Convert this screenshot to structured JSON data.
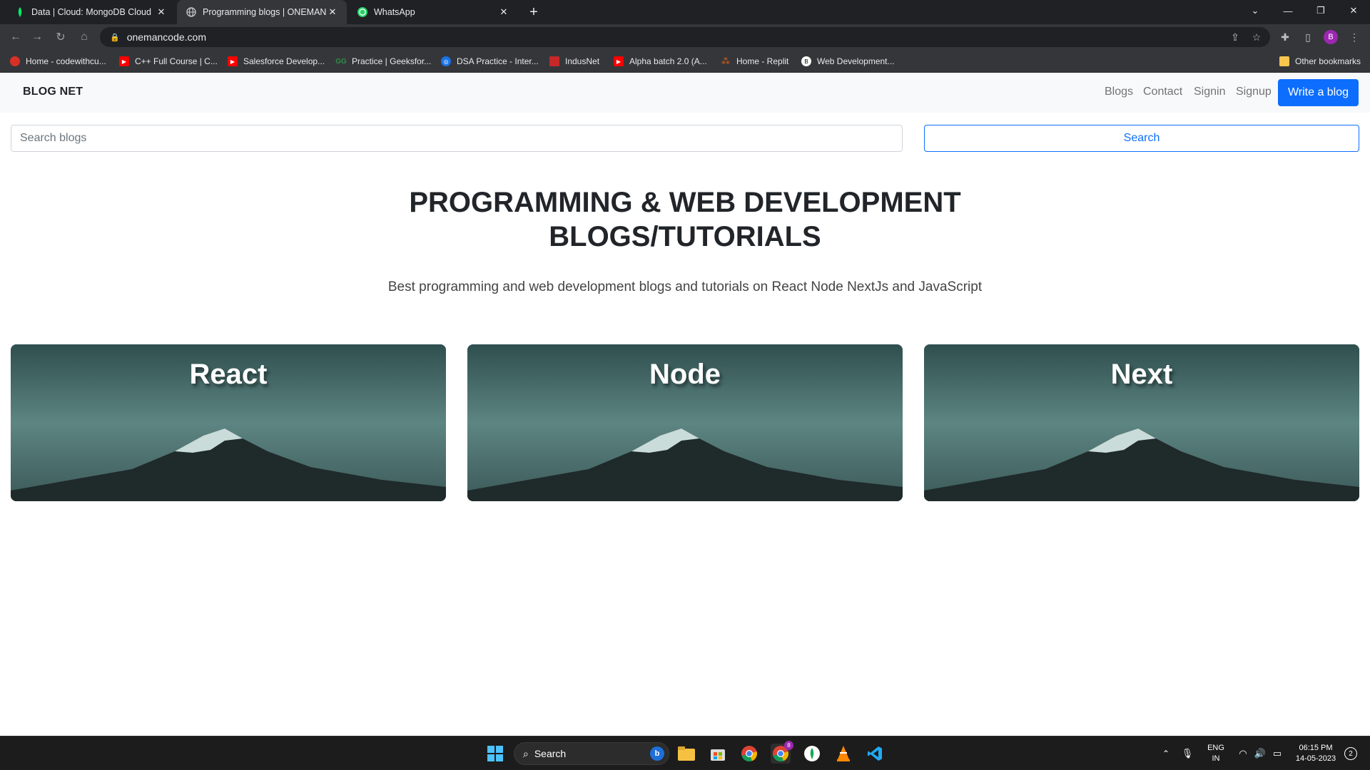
{
  "browser": {
    "tabs": [
      {
        "title": "Data | Cloud: MongoDB Cloud",
        "icon": "mongodb-leaf-icon",
        "active": false
      },
      {
        "title": "Programming blogs | ONEMANCODE",
        "icon": "globe-icon",
        "active": true
      },
      {
        "title": "WhatsApp",
        "icon": "whatsapp-icon",
        "active": false
      }
    ],
    "url": "onemancode.com",
    "profile_initial": "B",
    "bookmarks": [
      {
        "label": "Home - codewithcu...",
        "icon": "codewithharry-icon",
        "color": "#d93025"
      },
      {
        "label": "C++ Full Course | C...",
        "icon": "youtube-icon",
        "color": "#ff0000"
      },
      {
        "label": "Salesforce Develop...",
        "icon": "youtube-icon",
        "color": "#ff0000"
      },
      {
        "label": "Practice | Geeksfor...",
        "icon": "geeksforgeeks-icon",
        "color": "#2f8d46"
      },
      {
        "label": "DSA Practice - Inter...",
        "icon": "interviewbit-icon",
        "color": "#1a73e8"
      },
      {
        "label": "IndusNet",
        "icon": "indusnet-icon",
        "color": "#c62828"
      },
      {
        "label": "Alpha batch 2.0 (A...",
        "icon": "youtube-icon",
        "color": "#ff0000"
      },
      {
        "label": "Home - Replit",
        "icon": "replit-icon",
        "color": "#f26207"
      },
      {
        "label": "Web Development...",
        "icon": "webdev-icon",
        "color": "#ffffff"
      }
    ],
    "other_bookmarks": "Other bookmarks"
  },
  "navbar": {
    "brand": "BLOG NET",
    "links": [
      "Blogs",
      "Contact",
      "Signin",
      "Signup"
    ],
    "cta": "Write a blog"
  },
  "search": {
    "placeholder": "Search blogs",
    "button": "Search"
  },
  "hero": {
    "title_line1": "PROGRAMMING & WEB DEVELOPMENT",
    "title_line2": "BLOGS/TUTORIALS",
    "subtitle": "Best programming and web development blogs and tutorials on React Node NextJs and JavaScript"
  },
  "categories": [
    {
      "title": "React"
    },
    {
      "title": "Node"
    },
    {
      "title": "Next"
    }
  ],
  "taskbar": {
    "search_label": "Search",
    "chrome_badge": "8",
    "lang_line1": "ENG",
    "lang_line2": "IN",
    "time": "06:15 PM",
    "date": "14-05-2023",
    "notifications": "2"
  },
  "colors": {
    "primary": "#0d6efd",
    "navbar_bg": "#f8f9fa",
    "browser_dark": "#202124",
    "card_teal": "#3e5f5e"
  }
}
